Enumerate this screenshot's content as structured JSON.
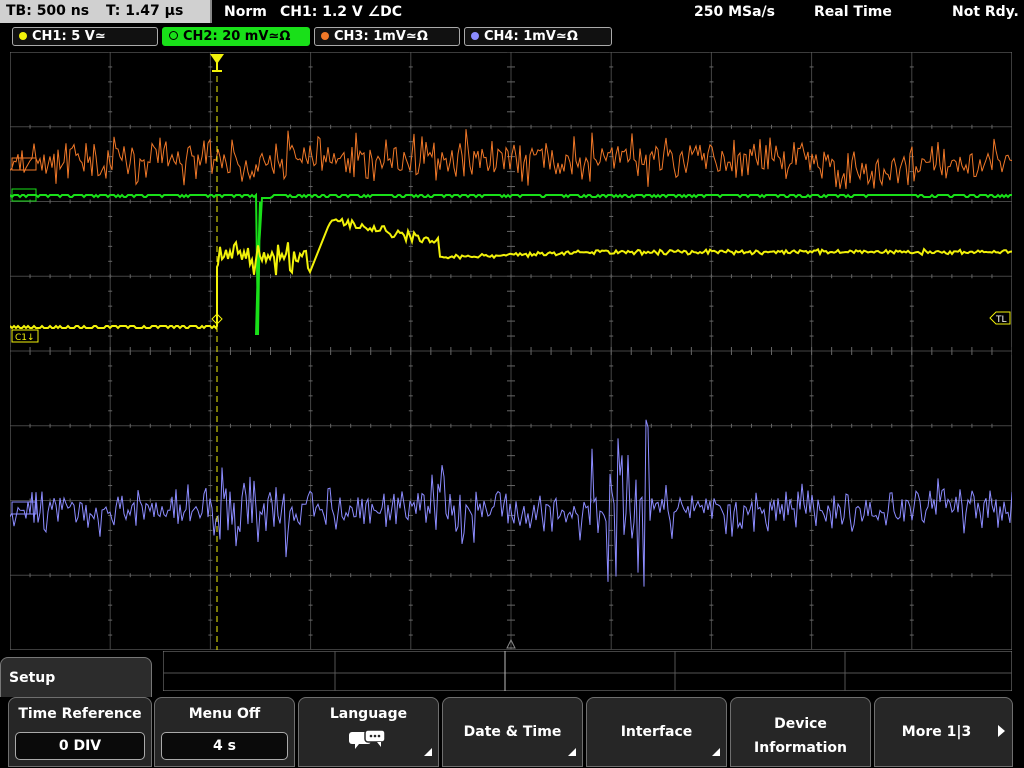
{
  "topbar": {
    "timebase": "TB: 500 ns",
    "trigger_pos": "T: 1.47 µs",
    "trigger_mode": "Norm",
    "trigger_settings": "CH1: 1.2 V ∠DC",
    "sample_rate": "250 MSa/s",
    "acq_mode": "Real Time",
    "status": "Not Rdy."
  },
  "channels": [
    {
      "label": "CH1: 5 V≃",
      "color": "#f2f20a"
    },
    {
      "label": "CH2: 20 mV≃Ω",
      "color": "#19e019",
      "active": true
    },
    {
      "label": "CH3: 1mV≃Ω",
      "color": "#f07828"
    },
    {
      "label": "CH4: 1mV≃Ω",
      "color": "#8c8cff"
    }
  ],
  "markers": {
    "c1": "C1↓",
    "tl": "TL"
  },
  "menu": {
    "tab": "Setup",
    "time_reference": {
      "title": "Time Reference",
      "value": "0 DIV"
    },
    "menu_off": {
      "title": "Menu Off",
      "value": "4 s"
    },
    "language": {
      "title": "Language"
    },
    "date_time": {
      "title": "Date & Time"
    },
    "interface": {
      "title": "Interface"
    },
    "device_info": {
      "title": "Device Information"
    },
    "more": {
      "title": "More 1|3"
    }
  },
  "colors": {
    "ch1": "#f2f20a",
    "ch2": "#19e019",
    "ch3": "#f07828",
    "ch4": "#8c8cff",
    "grid": "#555555"
  },
  "icons": {
    "language": "speech-bubbles-icon",
    "more": "arrow-right-icon"
  }
}
